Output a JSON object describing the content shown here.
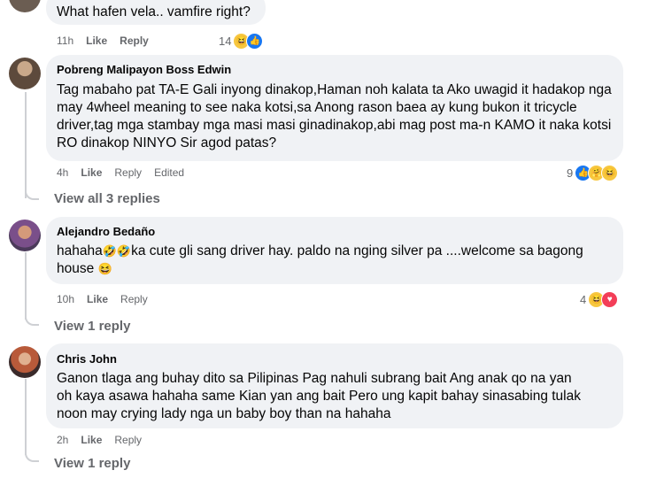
{
  "comments": [
    {
      "author": "",
      "text": "What hafen vela.. vamfire right?",
      "time": "11h",
      "like": "Like",
      "reply": "Reply",
      "edited": "",
      "reaction_count": "14",
      "reactions": [
        "haha",
        "like"
      ]
    },
    {
      "author": "Pobreng Malipayon Boss Edwin",
      "text": "Tag mabaho pat TA-E Gali inyong dinakop,Haman noh kalata ta Ako uwagid it hadakop nga may 4wheel meaning to see naka kotsi,sa Anong rason baea ay kung bukon it tricycle driver,tag mga stambay mga masi masi ginadinakop,abi mag post ma-n KAMO it naka kotsi RO dinakop NINYO Sir agod patas?",
      "time": "4h",
      "like": "Like",
      "reply": "Reply",
      "edited": "Edited",
      "reaction_count": "9",
      "reactions": [
        "like",
        "care",
        "haha"
      ],
      "view_replies": "View all 3 replies"
    },
    {
      "author": "Alejandro Bedaño",
      "text_part1": "hahaha",
      "text_part2": "ka cute gli sang driver hay. paldo na nging silver pa ....welcome sa bagong house",
      "time": "10h",
      "like": "Like",
      "reply": "Reply",
      "reaction_count": "4",
      "reactions": [
        "haha",
        "love"
      ],
      "view_replies": "View 1 reply"
    },
    {
      "author": "Chris John",
      "text": "Ganon tlaga ang buhay dito sa Pilipinas Pag nahuli subrang bait Ang anak qo na yan oh kaya asawa hahaha same Kian yan ang bait Pero ung kapit bahay sinasabing tulak noon may crying lady nga un baby boy than na hahaha",
      "time": "2h",
      "like": "Like",
      "reply": "Reply",
      "view_replies": "View 1 reply"
    }
  ],
  "colors": {
    "bubble": "#f0f2f5",
    "meta_text": "#65676b",
    "like_blue": "#1877f2",
    "haha_yellow": "#f7c740",
    "love_red": "#f33e58"
  }
}
